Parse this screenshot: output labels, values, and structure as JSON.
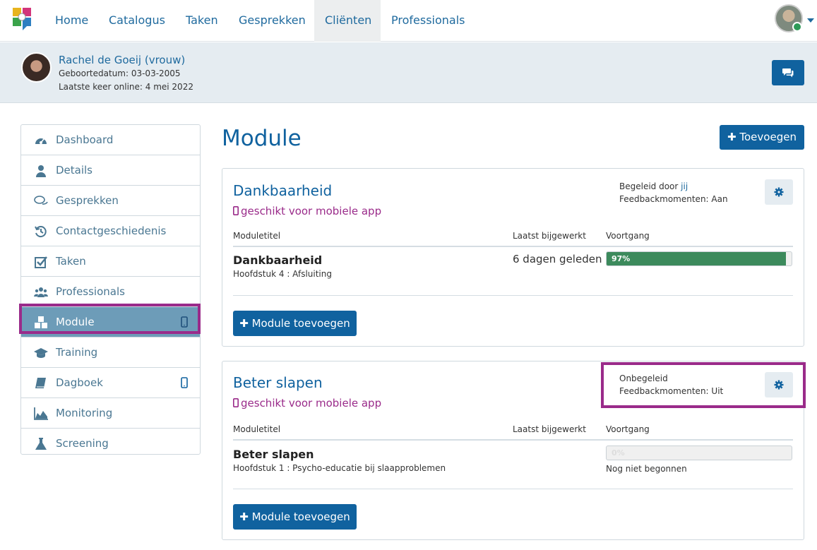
{
  "nav": {
    "items": [
      "Home",
      "Catalogus",
      "Taken",
      "Gesprekken",
      "Cliënten",
      "Professionals"
    ],
    "active": "Cliënten"
  },
  "client": {
    "name": "Rachel de Goeij (vrouw)",
    "birthdate": "Geboortedatum: 03-03-2005",
    "last_online": "Laatste keer online: 4 mei 2022"
  },
  "sidebar": {
    "items": [
      {
        "label": "Dashboard",
        "icon": "dashboard-icon"
      },
      {
        "label": "Details",
        "icon": "user-icon"
      },
      {
        "label": "Gesprekken",
        "icon": "chat-icon"
      },
      {
        "label": "Contactgeschiedenis",
        "icon": "history-icon"
      },
      {
        "label": "Taken",
        "icon": "checkbox-icon"
      },
      {
        "label": "Professionals",
        "icon": "users-icon"
      },
      {
        "label": "Module",
        "icon": "cubes-icon",
        "mobile": true,
        "active": true
      },
      {
        "label": "Training",
        "icon": "graduation-cap-icon"
      },
      {
        "label": "Dagboek",
        "icon": "book-icon",
        "mobile": true
      },
      {
        "label": "Monitoring",
        "icon": "area-chart-icon"
      },
      {
        "label": "Screening",
        "icon": "flask-icon"
      }
    ]
  },
  "main": {
    "title": "Module",
    "add_label": "Toevoegen",
    "col_moduletitel": "Moduletitel",
    "col_updated": "Laatst bijgewerkt",
    "col_progress": "Voortgang",
    "module_add_label": "Module toevoegen",
    "mobile_label": "geschikt voor mobiele app",
    "cards": [
      {
        "title": "Dankbaarheid",
        "guide_prefix": "Begeleid door ",
        "guide_link": "jij",
        "feedback": "Feedbackmomenten: Aan",
        "module_title": "Dankbaarheid",
        "chapter": "Hoofdstuk 4 : Afsluiting",
        "updated": "6 dagen geleden",
        "progress": 97,
        "progress_label": "97%"
      },
      {
        "title": "Beter slapen",
        "guide_prefix": "Onbegeleid",
        "guide_link": "",
        "feedback": "Feedbackmomenten: Uit",
        "module_title": "Beter slapen",
        "chapter": "Hoofdstuk 1 : Psycho-educatie bij slaapproblemen",
        "updated": "",
        "progress": 0,
        "progress_label": "0%",
        "status": "Nog niet begonnen"
      }
    ]
  },
  "colors": {
    "primary": "#10629f",
    "highlight": "#9a2b8a",
    "progress": "#3c8a5c"
  }
}
